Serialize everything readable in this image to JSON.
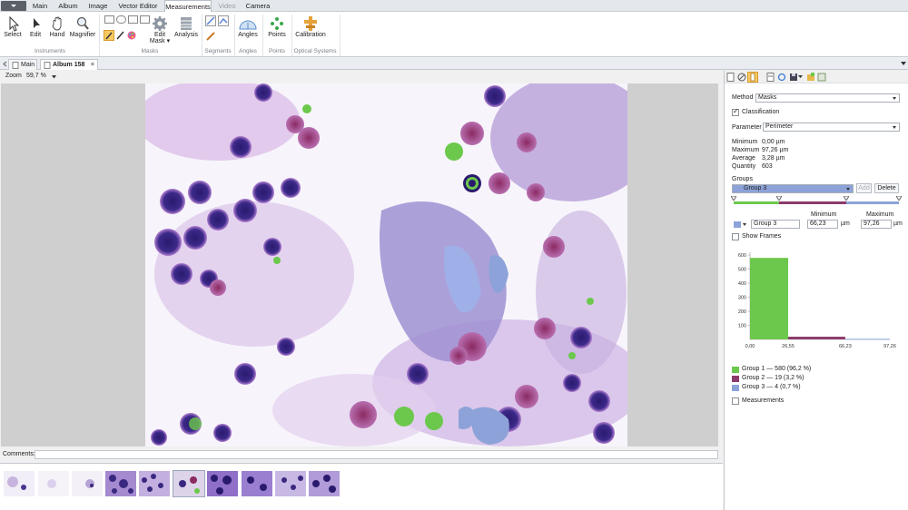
{
  "menubar": {
    "tabs": [
      {
        "label": "Main",
        "active": false,
        "disabled": false
      },
      {
        "label": "Album",
        "active": false,
        "disabled": false
      },
      {
        "label": "Image",
        "active": false,
        "disabled": false
      },
      {
        "label": "Vector Editor",
        "active": false,
        "disabled": false
      },
      {
        "label": "Measurements",
        "active": true,
        "disabled": false
      },
      {
        "label": "Video",
        "active": false,
        "disabled": true
      },
      {
        "label": "Camera",
        "active": false,
        "disabled": false
      }
    ]
  },
  "ribbon": {
    "select": "Select",
    "edit": "Edit",
    "hand": "Hand",
    "magnifier": "Magnifier",
    "edit_mask": "Edit\nMask ▾",
    "analysis": "Analysis",
    "angles": "Angles",
    "points": "Points",
    "calibration": "Calibration",
    "groups": {
      "instruments": "Instruments",
      "masks": "Masks",
      "segments": "Segments",
      "angles": "Angles",
      "points": "Points",
      "optical": "Optical Systems"
    }
  },
  "doctabs": {
    "main": "Main",
    "album": "Album 158"
  },
  "zoom": {
    "label": "Zoom",
    "value": "59,7 %"
  },
  "comments": {
    "label": "Comments:"
  },
  "panel": {
    "method_label": "Method",
    "method_value": "Masks",
    "classification_label": "Classification",
    "parameter_label": "Parameter",
    "parameter_value": "Perimeter",
    "stats": {
      "minimum_label": "Minimum",
      "minimum_value": "0,00 µm",
      "maximum_label": "Maximum",
      "maximum_value": "97,26 µm",
      "average_label": "Average",
      "average_value": "3,28 µm",
      "quantity_label": "Quantity",
      "quantity_value": "603"
    },
    "groups_label": "Groups",
    "group_selected": "Group 3",
    "add_label": "Add",
    "delete_label": "Delete",
    "col_minimum": "Minimum",
    "col_maximum": "Maximum",
    "group_name_value": "Group 3",
    "min_value": "66,23",
    "max_value": "97,26",
    "unit": "µm",
    "show_frames_label": "Show Frames",
    "measurements_label": "Measurements",
    "legend": [
      {
        "text": "Group 1  —  580 (96,2 %)",
        "color": "#6cc84c"
      },
      {
        "text": "Group 2  —  19 (3,2 %)",
        "color": "#8b3a6a"
      },
      {
        "text": "Group 3  —  4 (0,7 %)",
        "color": "#8da2d8"
      }
    ]
  },
  "chart_data": {
    "type": "bar",
    "title": "",
    "xlabel": "",
    "ylabel": "",
    "x_ticks": [
      "0,00",
      "26,55",
      "66,23",
      "97,26"
    ],
    "y_ticks": [
      "100",
      "200",
      "300",
      "400",
      "500",
      "600"
    ],
    "ylim": [
      0,
      620
    ],
    "series": [
      {
        "name": "Group 1",
        "x_range": [
          0.0,
          26.55
        ],
        "value": 580,
        "color": "#6cc84c"
      },
      {
        "name": "Group 2",
        "x_range": [
          26.55,
          66.23
        ],
        "value": 19,
        "color": "#8b3a6a"
      },
      {
        "name": "Group 3",
        "x_range": [
          66.23,
          97.26
        ],
        "value": 4,
        "color": "#8da2d8"
      }
    ]
  }
}
